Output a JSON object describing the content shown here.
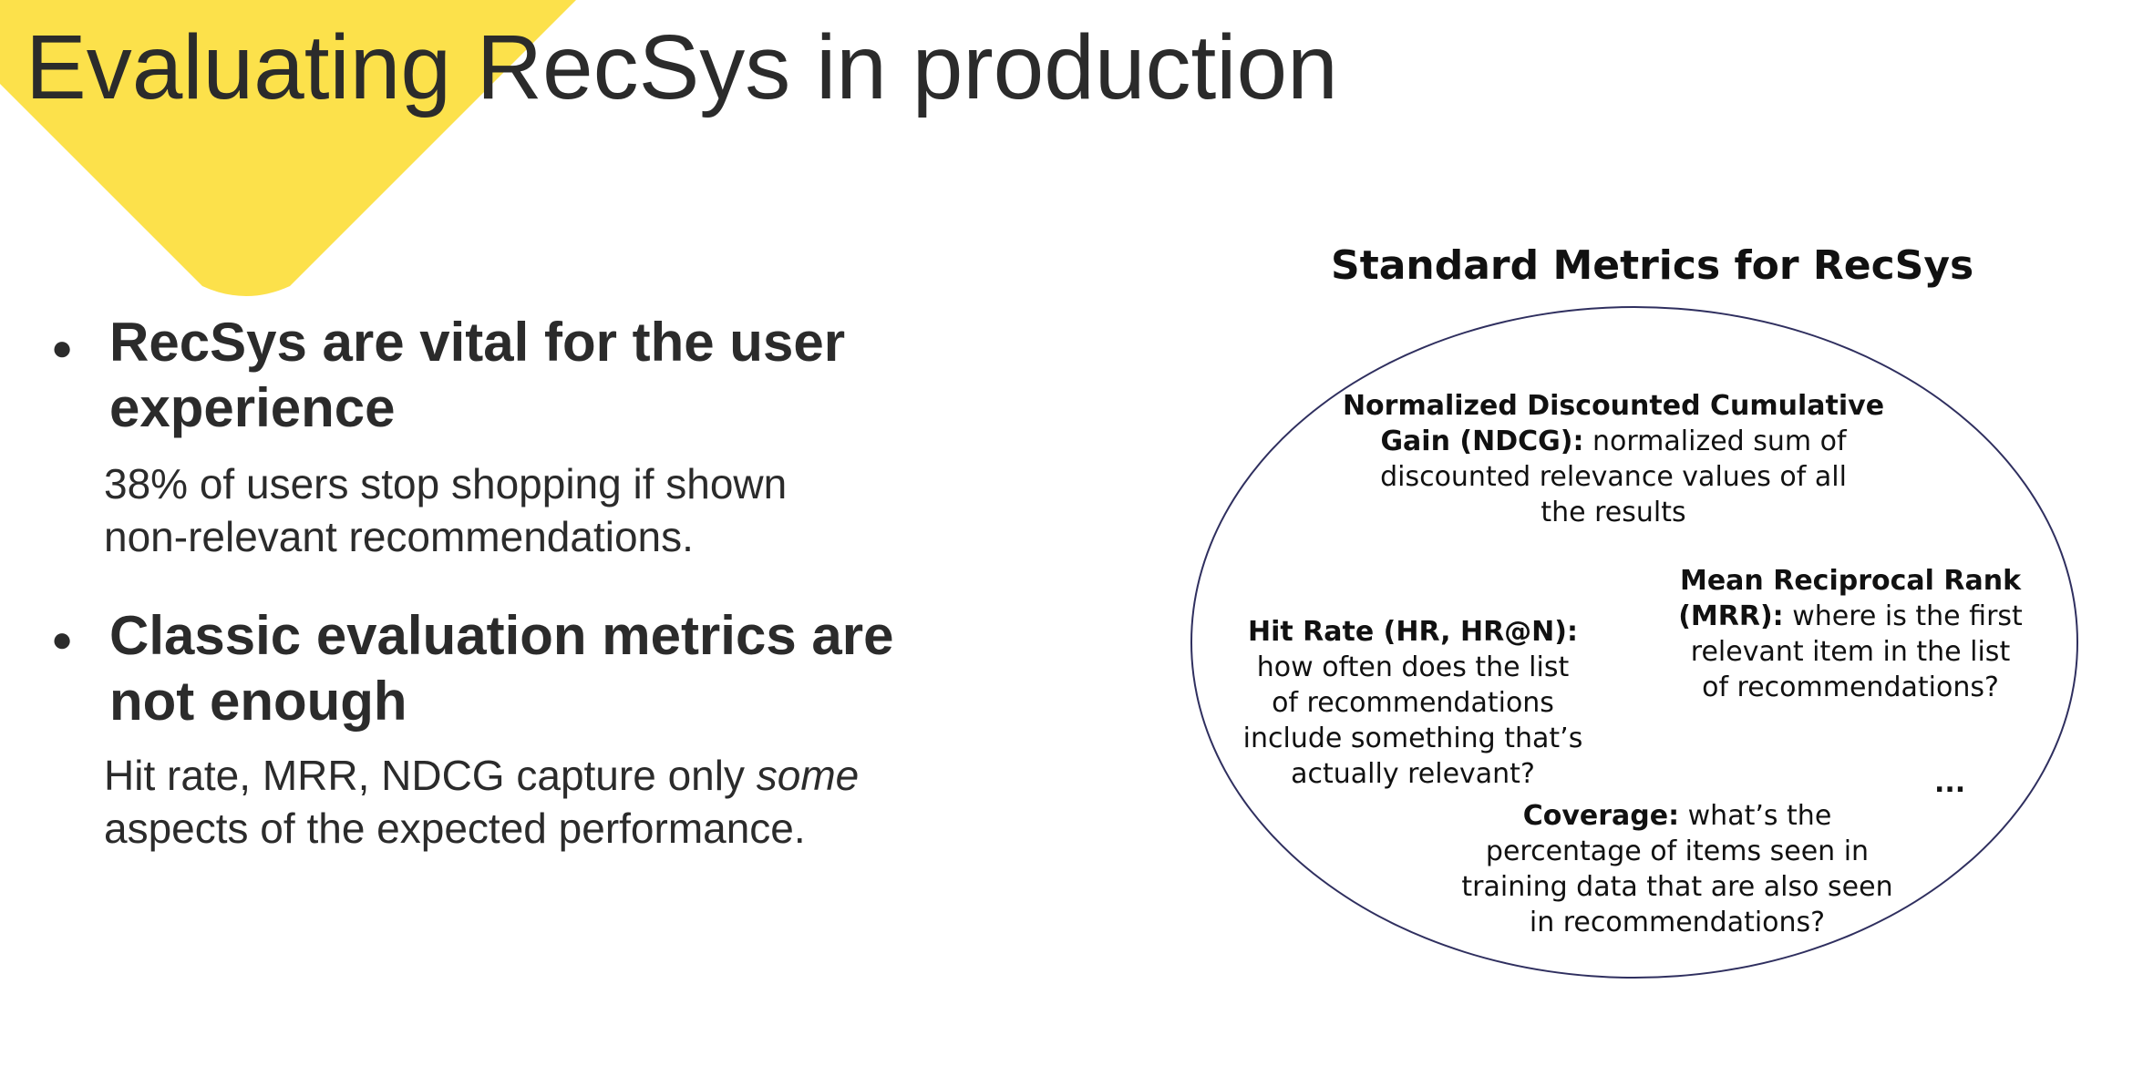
{
  "slide": {
    "title": "Evaluating RecSys in production",
    "accent_color": "#FCE14B"
  },
  "bullets": [
    {
      "heading_line1": "RecSys are vital for the user",
      "heading_line2": "experience",
      "body_line1": "38% of users stop shopping if shown",
      "body_line2": "non-relevant recommendations."
    },
    {
      "heading_line1": "Classic evaluation metrics are",
      "heading_line2": "not enough",
      "body_line1_prefix": "Hit rate, MRR, NDCG capture only ",
      "body_line1_emphasis": "some",
      "body_line2": "aspects of the expected performance."
    }
  ],
  "metrics_panel": {
    "title": "Standard Metrics for RecSys",
    "ndcg": {
      "line1": "Normalized Discounted Cumulative",
      "line2_bold": "Gain (NDCG):",
      "line2_rest": " normalized sum of",
      "line3": "discounted relevance values of all",
      "line4": "the results"
    },
    "mrr": {
      "line1": "Mean Reciprocal Rank",
      "line2_bold": "(MRR):",
      "line2_rest": " where is the first",
      "line3": "relevant item in the list",
      "line4": "of recommendations?"
    },
    "hit_rate": {
      "line1": "Hit Rate (HR, HR@N):",
      "line2": "how often does the list",
      "line3": "of recommendations",
      "line4": "include something that’s",
      "line5": "actually relevant?"
    },
    "coverage": {
      "line1_bold": "Coverage:",
      "line1_rest": " what’s the",
      "line2": "percentage of items seen in",
      "line3": "training data that are also seen",
      "line4": "in recommendations?"
    },
    "ellipsis": "..."
  }
}
